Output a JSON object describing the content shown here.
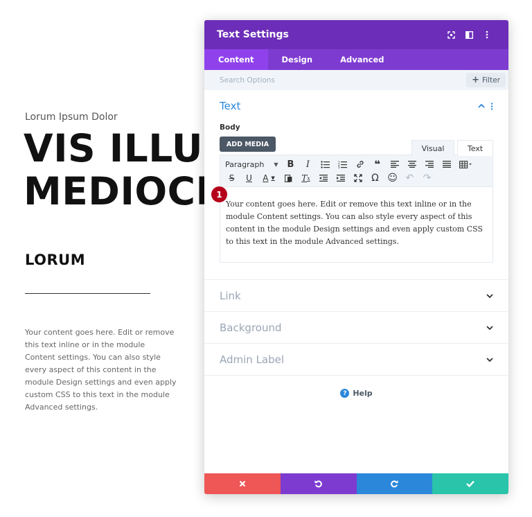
{
  "page": {
    "eyebrow": "Lorum Ipsum Dolor",
    "headline": "VIS ILLUD\nMEDIOCREM",
    "subheading": "LORUM",
    "body": "Your content goes here. Edit or remove this text inline or in the module Content settings. You can also style every aspect of this content in the module Design settings and even apply custom CSS to this text in the module Advanced settings."
  },
  "modal": {
    "title": "Text Settings",
    "header_icons": [
      "expand-icon",
      "split-view-icon",
      "more-options-icon"
    ],
    "tabs": [
      {
        "label": "Content",
        "active": true
      },
      {
        "label": "Design",
        "active": false
      },
      {
        "label": "Advanced",
        "active": false
      }
    ],
    "search": {
      "placeholder": "Search Options",
      "filter_label": "Filter"
    },
    "text_section": {
      "title": "Text",
      "body_label": "Body",
      "add_media_label": "ADD MEDIA",
      "mode_tabs": [
        "Visual",
        "Text"
      ],
      "format_select": "Paragraph",
      "badge": "1",
      "editor_content": "Your content goes here. Edit or remove this text inline or in the module Content settings. You can also style every aspect of this content in the module Design settings and even apply custom CSS to this text in the module Advanced settings."
    },
    "collapsed_sections": [
      "Link",
      "Background",
      "Admin Label"
    ],
    "help_label": "Help",
    "footer_colors": {
      "cancel": "#ef5656",
      "undo": "#7e3bd0",
      "redo": "#2b87da",
      "save": "#29c4a9"
    }
  },
  "colors": {
    "header": "#6c2eb9",
    "tabs_bar": "#7e3bd0",
    "active_tab": "#8f42ec",
    "accent_blue": "#2b87da",
    "badge": "#b5001c"
  }
}
